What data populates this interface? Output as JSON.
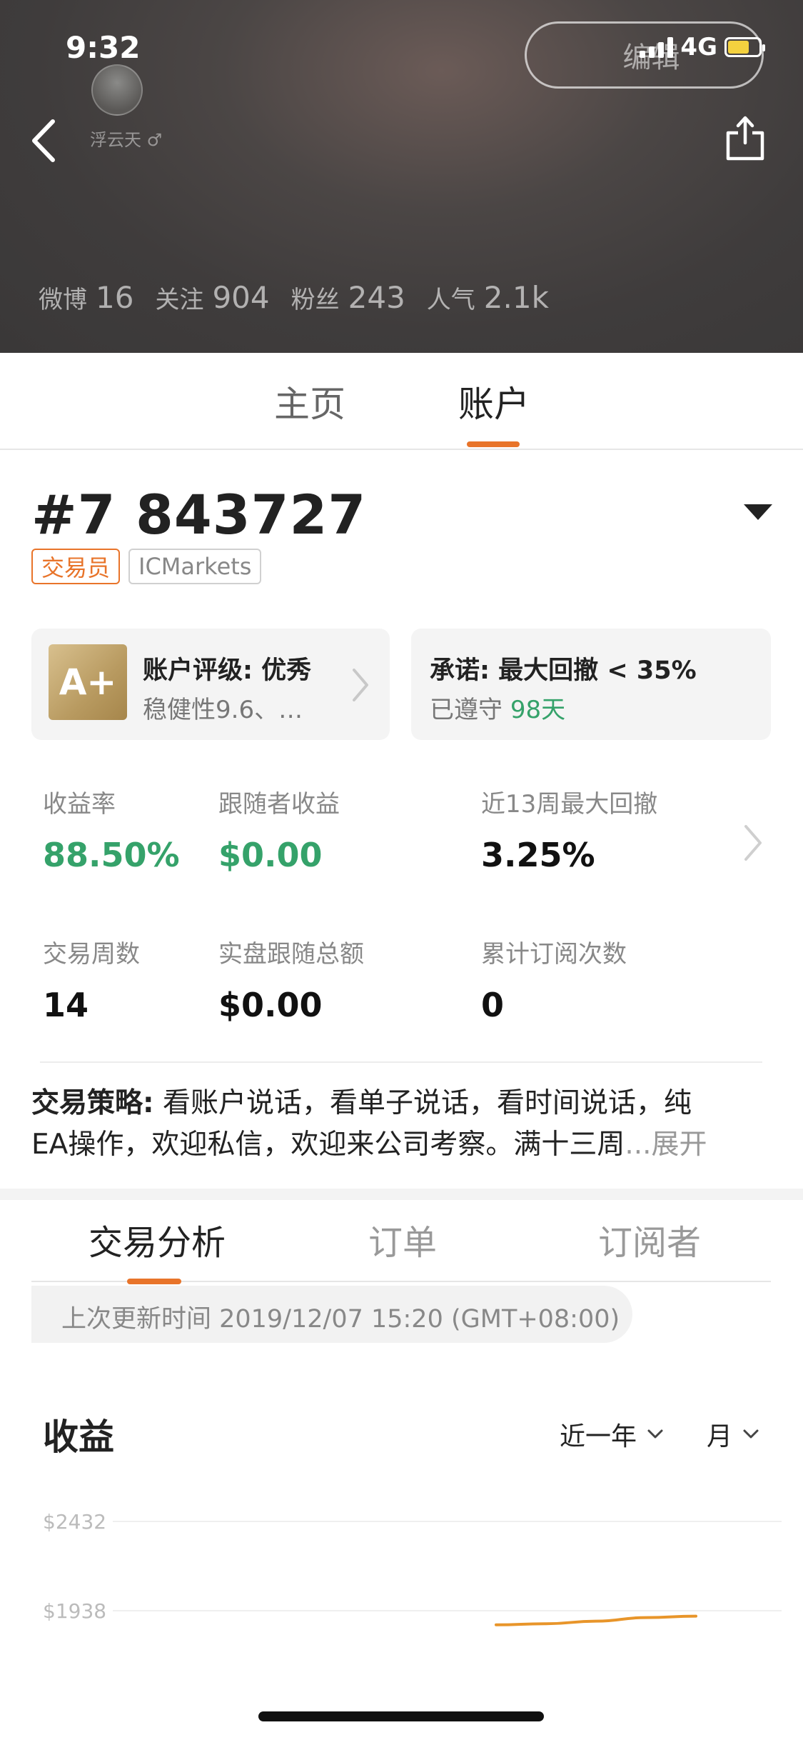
{
  "status_bar": {
    "time": "9:32",
    "network": "4G",
    "battery_color": "#f4d13f"
  },
  "profile": {
    "edit_label": "编辑",
    "nickname": "浮云天 ♂",
    "stats": [
      {
        "label": "微博",
        "value": "16"
      },
      {
        "label": "关注",
        "value": "904"
      },
      {
        "label": "粉丝",
        "value": "243"
      },
      {
        "label": "人气",
        "value": "2.1k"
      }
    ]
  },
  "top_tabs": [
    {
      "label": "主页",
      "active": false
    },
    {
      "label": "账户",
      "active": true
    }
  ],
  "account": {
    "id": "#7 843727",
    "badges": {
      "role": "交易员",
      "broker": "ICMarkets"
    },
    "rating_card": {
      "grade": "A+",
      "title": "账户评级: 优秀",
      "subtitle": "稳健性9.6、…"
    },
    "promise_card": {
      "title": "承诺: 最大回撤 < 35%",
      "kept_prefix": "已遵守",
      "kept_days": "98天"
    }
  },
  "metrics": [
    {
      "label": "收益率",
      "value": "88.50%",
      "color": "green"
    },
    {
      "label": "跟随者收益",
      "value": "$0.00",
      "color": "green"
    },
    {
      "label": "近13周最大回撤",
      "value": "3.25%",
      "color": "black"
    },
    {
      "label": "交易周数",
      "value": "14",
      "color": "black"
    },
    {
      "label": "实盘跟随总额",
      "value": "$0.00",
      "color": "black"
    },
    {
      "label": "累计订阅次数",
      "value": "0",
      "color": "black"
    }
  ],
  "strategy": {
    "label": "交易策略:",
    "line1": " 看账户说话，看单子说话，看时间说话，纯",
    "line2": "EA操作，欢迎私信，欢迎来公司考察。满十三周",
    "more": "...展开"
  },
  "sub_tabs": [
    {
      "label": "交易分析",
      "active": true
    },
    {
      "label": "订单",
      "active": false
    },
    {
      "label": "订阅者",
      "active": false
    }
  ],
  "update_time": "上次更新时间 2019/12/07 15:20 (GMT+08:00)",
  "earnings": {
    "title": "收益",
    "range_filter": "近一年",
    "period_filter": "月"
  },
  "chart_data": {
    "type": "line",
    "title": "收益",
    "y_ticks": [
      "$2432",
      "$1938"
    ],
    "series": [
      {
        "values": [
          1860,
          1866,
          1880,
          1900,
          1908
        ]
      }
    ],
    "line_color": "#e8952a",
    "grid": true
  },
  "colors": {
    "accent": "#e8742a",
    "positive": "#35a26a"
  }
}
